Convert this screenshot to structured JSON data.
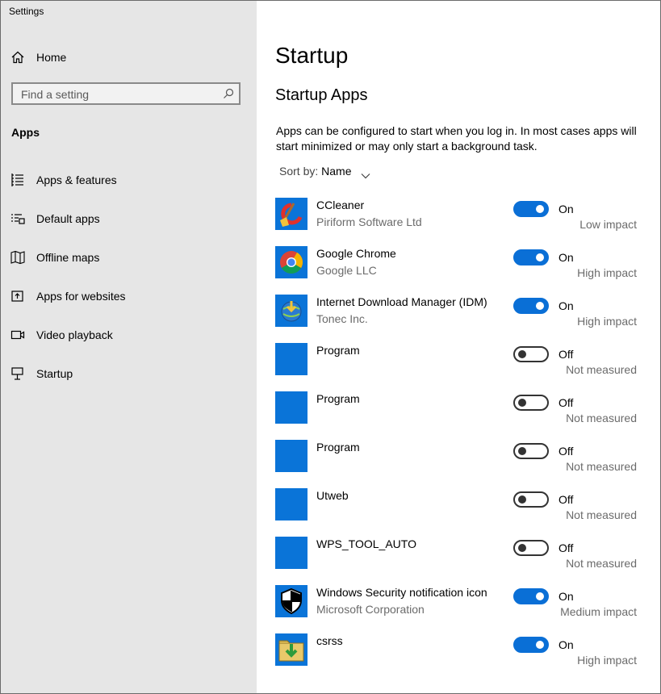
{
  "window": {
    "title": "Settings"
  },
  "sidebar": {
    "home_label": "Home",
    "search_placeholder": "Find a setting",
    "section_label": "Apps",
    "items": [
      {
        "label": "Apps & features",
        "icon": "list-icon"
      },
      {
        "label": "Default apps",
        "icon": "default-apps-icon"
      },
      {
        "label": "Offline maps",
        "icon": "map-icon"
      },
      {
        "label": "Apps for websites",
        "icon": "open-window-icon"
      },
      {
        "label": "Video playback",
        "icon": "video-icon"
      },
      {
        "label": "Startup",
        "icon": "startup-icon"
      }
    ]
  },
  "main": {
    "page_title": "Startup",
    "subtitle": "Startup Apps",
    "description": "Apps can be configured to start when you log in. In most cases apps will start minimized or may only start a background task.",
    "sort_label": "Sort by:",
    "sort_value": "Name",
    "apps": [
      {
        "name": "CCleaner",
        "publisher": "Piriform Software Ltd",
        "enabled": true,
        "state": "On",
        "impact": "Low impact",
        "icon": "ccleaner-icon"
      },
      {
        "name": "Google Chrome",
        "publisher": "Google LLC",
        "enabled": true,
        "state": "On",
        "impact": "High impact",
        "icon": "chrome-icon"
      },
      {
        "name": "Internet Download Manager (IDM)",
        "publisher": "Tonec Inc.",
        "enabled": true,
        "state": "On",
        "impact": "High impact",
        "icon": "idm-icon"
      },
      {
        "name": "Program",
        "publisher": "",
        "enabled": false,
        "state": "Off",
        "impact": "Not measured",
        "icon": "blank-app-icon"
      },
      {
        "name": "Program",
        "publisher": "",
        "enabled": false,
        "state": "Off",
        "impact": "Not measured",
        "icon": "blank-app-icon"
      },
      {
        "name": "Program",
        "publisher": "",
        "enabled": false,
        "state": "Off",
        "impact": "Not measured",
        "icon": "blank-app-icon"
      },
      {
        "name": "Utweb",
        "publisher": "",
        "enabled": false,
        "state": "Off",
        "impact": "Not measured",
        "icon": "blank-app-icon"
      },
      {
        "name": "WPS_TOOL_AUTO",
        "publisher": "",
        "enabled": false,
        "state": "Off",
        "impact": "Not measured",
        "icon": "blank-app-icon"
      },
      {
        "name": "Windows Security notification icon",
        "publisher": "Microsoft Corporation",
        "enabled": true,
        "state": "On",
        "impact": "Medium impact",
        "icon": "shield-icon"
      },
      {
        "name": "csrss",
        "publisher": "",
        "enabled": true,
        "state": "On",
        "impact": "High impact",
        "icon": "folder-download-icon"
      }
    ]
  },
  "colors": {
    "accent": "#0a6fd6",
    "sidebar_bg": "#e6e6e6",
    "tile_blue": "#0a74d8"
  }
}
